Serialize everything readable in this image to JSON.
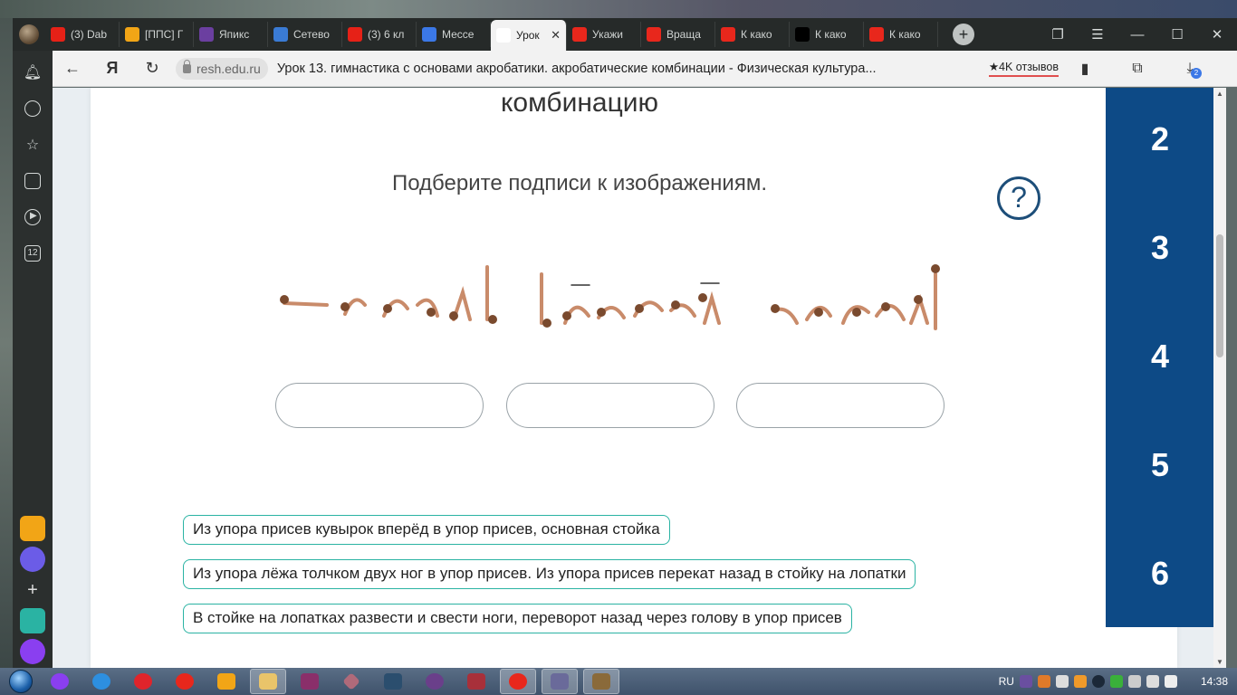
{
  "browser": {
    "tabs": [
      {
        "label": "(3) Dab",
        "icon": "youtube-icon",
        "color": "#e62117"
      },
      {
        "label": "[ППС] Г",
        "icon": "pps-icon",
        "color": "#f2a516"
      },
      {
        "label": "Япикс",
        "icon": "yandex-icon",
        "color": "#6b3fa0"
      },
      {
        "label": "Сетево",
        "icon": "school-net-icon",
        "color": "#3a7bd5"
      },
      {
        "label": "(3) 6 кл",
        "icon": "youtube-icon",
        "color": "#e62117"
      },
      {
        "label": "Мессе",
        "icon": "messenger-icon",
        "color": "#3b78e7"
      },
      {
        "label": "Урок",
        "icon": "resh-icon",
        "color": "#ffffff",
        "active": true
      },
      {
        "label": "Укажи",
        "icon": "yandex-icon",
        "color": "#e8271c"
      },
      {
        "label": "Враща",
        "icon": "yandex-icon",
        "color": "#e8271c"
      },
      {
        "label": "К како",
        "icon": "yandex-icon",
        "color": "#e8271c"
      },
      {
        "label": "К како",
        "icon": "zen-icon",
        "color": "#000000"
      },
      {
        "label": "К како",
        "icon": "yandex-icon",
        "color": "#e8271c"
      }
    ],
    "url_domain": "resh.edu.ru",
    "page_title": "Урок 13. гимнастика с основами акробатики. акробатические комбинации - Физическая культура...",
    "reviews": "★4K отзывов",
    "downloads_badge": "2",
    "sidebar_badge": "12"
  },
  "lesson": {
    "heading": "комбинацию",
    "instruction": "Подберите подписи к изображениям.",
    "help_symbol": "?",
    "answer_chips": [
      "Из упора присев кувырок вперёд в упор присев, основная стойка",
      "Из упора лёжа толчком двух ног в упор присев. Из упора присев перекат назад в стойку на лопатки",
      "В стойке на лопатках развести и свести ноги, переворот назад через голову в упор присев"
    ],
    "drop_zones": 3,
    "task_numbers": [
      "2",
      "3",
      "4",
      "5",
      "6"
    ],
    "accent_color": "#2ab3a3",
    "nav_color": "#0d4a86"
  },
  "taskbar": {
    "language": "RU",
    "clock": "14:38"
  }
}
